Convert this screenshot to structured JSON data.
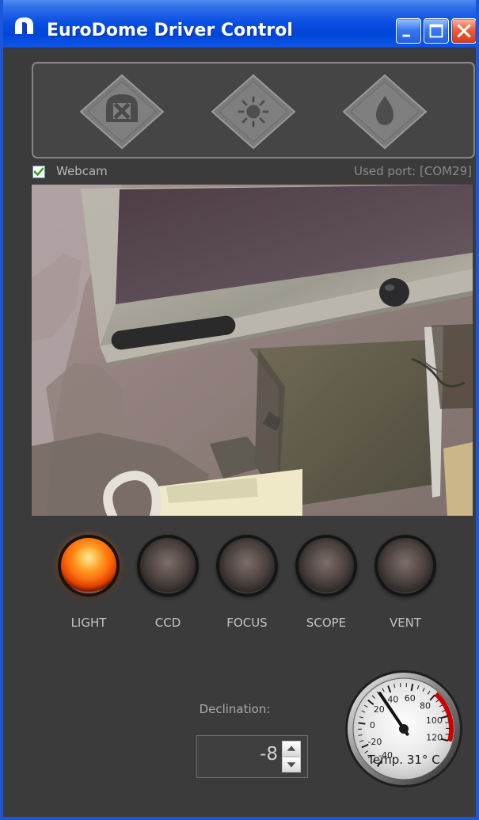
{
  "window": {
    "title": "EuroDome Driver Control"
  },
  "toolbar": {
    "buttons": [
      {
        "icon": "x-close-dome-icon"
      },
      {
        "icon": "sun-icon"
      },
      {
        "icon": "water-drop-icon"
      }
    ]
  },
  "webcam": {
    "label": "Webcam",
    "checked": true,
    "port_text": "Used port: [COM29]"
  },
  "indicators": [
    {
      "label": "LIGHT",
      "on": true
    },
    {
      "label": "CCD",
      "on": false
    },
    {
      "label": "FOCUS",
      "on": false
    },
    {
      "label": "SCOPE",
      "on": false
    },
    {
      "label": "VENT",
      "on": false
    }
  ],
  "declination": {
    "label": "Declination:",
    "value": "-8"
  },
  "temperature_gauge": {
    "label": "Temp. 31° C",
    "value": 31,
    "ticks": [
      "-40",
      "-20",
      "0",
      "20",
      "40",
      "60",
      "80",
      "100",
      "120"
    ],
    "danger_color": "#cc0000"
  },
  "colors": {
    "titlebar_blue": "#0a4ee1",
    "panel_gray": "#454545",
    "window_gray": "#3b3b3b",
    "indicator_on": "#ff6b0a"
  }
}
